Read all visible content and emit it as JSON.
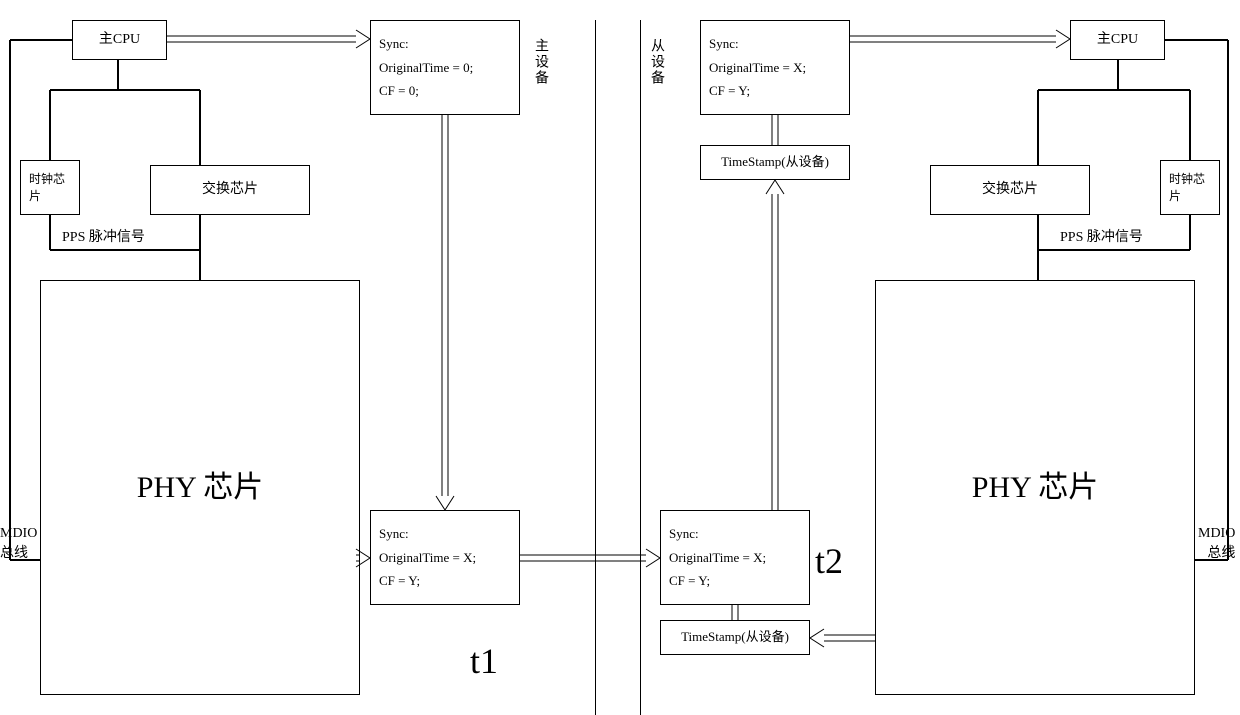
{
  "left": {
    "cpu": "主CPU",
    "clockChip": "时钟芯片",
    "switchChip": "交换芯片",
    "pps": "PPS",
    "ppsSignal": "脉冲信号",
    "phy": "PHY 芯片",
    "mdio1": "MDIO",
    "mdio2": "总线"
  },
  "right": {
    "cpu": "主CPU",
    "clockChip": "时钟芯片",
    "switchChip": "交换芯片",
    "pps": "PPS",
    "ppsSignal": "脉冲信号",
    "phy": "PHY 芯片",
    "mdio1": "MDIO",
    "mdio2": "总线"
  },
  "sync1": {
    "l1": "Sync:",
    "l2": "OriginalTime = 0;",
    "l3": "CF = 0;"
  },
  "sync2": {
    "l1": "Sync:",
    "l2": "OriginalTime = X;",
    "l3": "CF = Y;"
  },
  "sync3": {
    "l1": "Sync:",
    "l2": "OriginalTime = X;",
    "l3": "CF = Y;"
  },
  "sync4": {
    "l1": "Sync:",
    "l2": "OriginalTime = X;",
    "l3": "CF = Y;"
  },
  "timestamp1": "TimeStamp(从设备)",
  "timestamp2": "TimeStamp(从设备)",
  "masterDevice": "主设备",
  "slaveDevice": "从设备",
  "t1": "t1",
  "t2": "t2"
}
